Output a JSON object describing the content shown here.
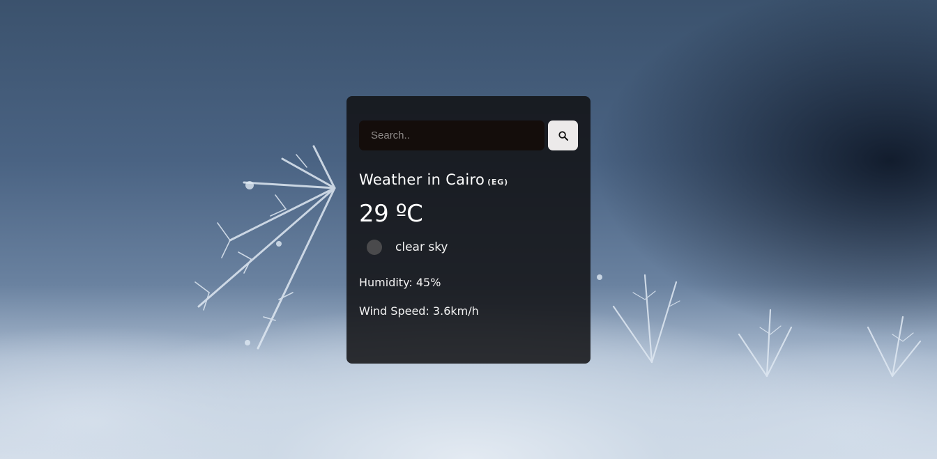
{
  "search": {
    "placeholder": "Search..",
    "value": "",
    "button_icon": "search-icon"
  },
  "weather": {
    "title": "Weather in Cairo",
    "country": "(EG)",
    "temperature": "29 ºC",
    "description": "clear sky",
    "condition_icon": "weather-condition-icon",
    "humidity": "Humidity: 45%",
    "wind": "Wind Speed: 3.6km/h"
  },
  "colors": {
    "card_background": "#121214",
    "search_input_background": "#140d0b",
    "search_button_background": "#eceaea",
    "text": "#ffffff"
  }
}
